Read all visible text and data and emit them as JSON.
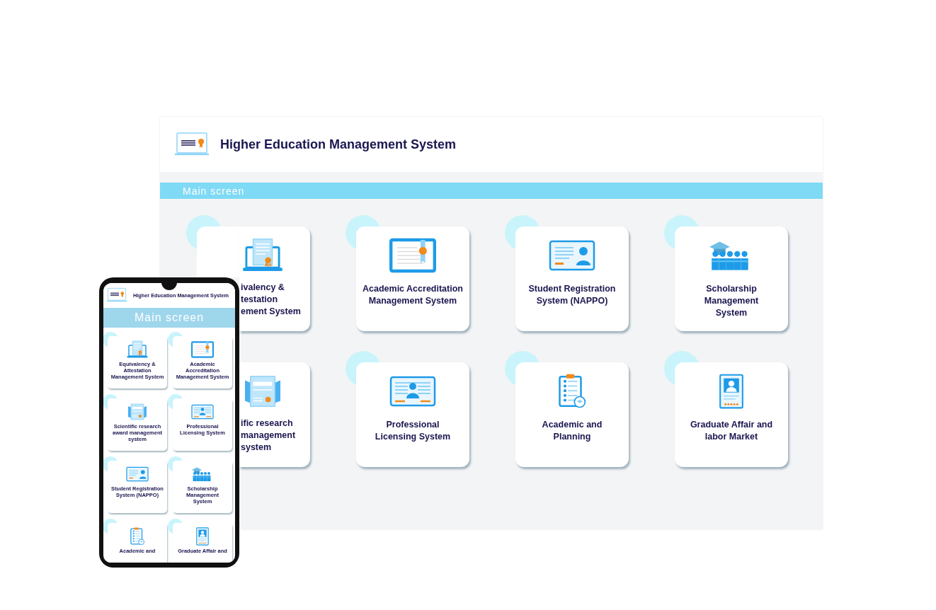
{
  "desktop": {
    "title": "Higher Education Management System",
    "section_bar": "Main screen",
    "cards": [
      {
        "title": "ivalency &\ntestation\nement System",
        "kind": "covered_lower_left"
      },
      {
        "title": "Academic Accreditation\nManagement System",
        "kind": "full"
      },
      {
        "title": "Student Registration\nSystem (NAPPO)",
        "kind": "full"
      },
      {
        "title": "Scholarship\nManagement\nSystem",
        "kind": "full"
      },
      {
        "title": "ific research\nmanagement\nsystem",
        "kind": "covered_left"
      },
      {
        "title": "Professional\nLicensing System",
        "kind": "full"
      },
      {
        "title": "Academic and\nPlanning",
        "kind": "full"
      },
      {
        "title": "Graduate Affair and\nlabor Market",
        "kind": "full"
      }
    ]
  },
  "mobile": {
    "title": "Higher Education Management System",
    "section_bar": "Main screen",
    "cards": [
      {
        "title": "Equivalency &\nAttestation\nManagement System"
      },
      {
        "title": "Academic Accreditation\nManagement System"
      },
      {
        "title": "Scientific research\naward management\nsystem"
      },
      {
        "title": "Professional\nLicensing System"
      },
      {
        "title": "Student Registration\nSystem (NAPPO)"
      },
      {
        "title": "Scholarship\nManagement\nSystem"
      },
      {
        "title": "Academic and"
      },
      {
        "title": "Graduate Affair and"
      }
    ]
  }
}
